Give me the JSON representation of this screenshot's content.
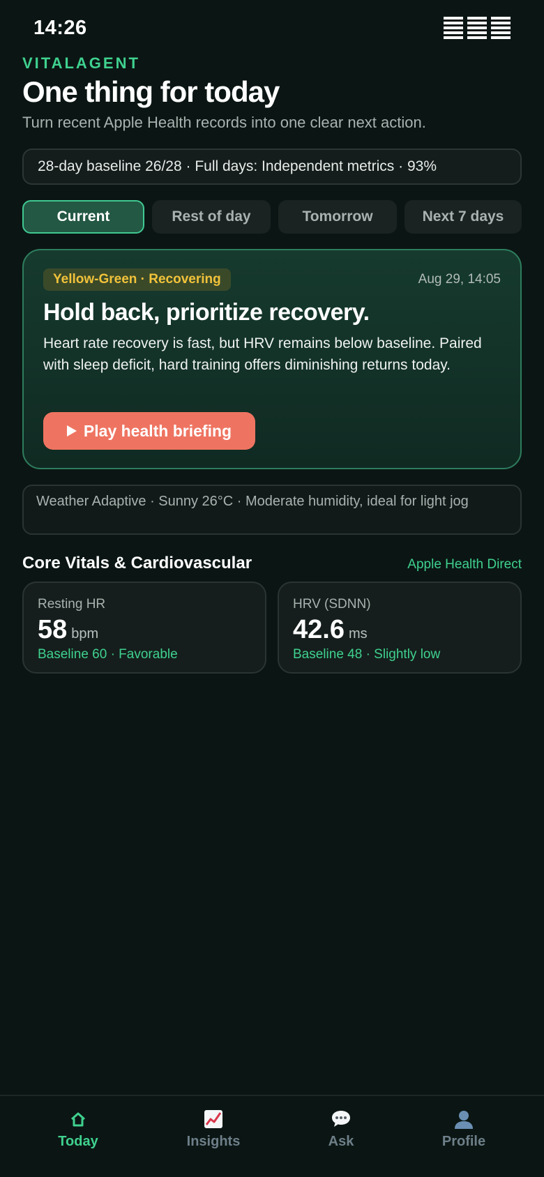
{
  "status_bar": {
    "time": "14:26",
    "icons": [
      "signal-icon",
      "wifi-icon",
      "battery-icon"
    ]
  },
  "header": {
    "brand": "VITALAGENT",
    "title": "One thing for today",
    "subtitle": "Turn recent Apple Health records into one clear next action."
  },
  "baseline": {
    "text": "28-day baseline 26/28 · Full days: Independent metrics · 93%"
  },
  "tabs": [
    {
      "label": "Current",
      "active": true
    },
    {
      "label": "Rest of day",
      "active": false
    },
    {
      "label": "Tomorrow",
      "active": false
    },
    {
      "label": "Next 7 days",
      "active": false
    }
  ],
  "recommendation": {
    "status_chip": "Yellow-Green · Recovering",
    "timestamp": "Aug 29, 14:05",
    "headline": "Hold back, prioritize recovery.",
    "body": "Heart rate recovery is fast, but HRV remains below baseline. Paired with sleep deficit, hard training offers diminishing returns today.",
    "play_button": "Play health briefing"
  },
  "weather": {
    "text": "Weather Adaptive · Sunny 26°C · Moderate humidity, ideal for light jog"
  },
  "section": {
    "title": "Core Vitals & Cardiovascular",
    "source_link": "Apple Health Direct"
  },
  "metrics": [
    {
      "label": "Resting HR",
      "value": "58",
      "unit": "bpm",
      "note": "Baseline 60 · Favorable"
    },
    {
      "label": "HRV (SDNN)",
      "value": "42.6",
      "unit": "ms",
      "note": "Baseline 48 · Slightly low"
    }
  ],
  "bottom_nav": [
    {
      "label": "Today",
      "icon": "home-icon",
      "active": true
    },
    {
      "label": "Insights",
      "icon": "chart-icon",
      "active": false
    },
    {
      "label": "Ask",
      "icon": "chat-bubble-icon",
      "active": false
    },
    {
      "label": "Profile",
      "icon": "person-icon",
      "active": false
    }
  ],
  "colors": {
    "background": "#0b1614",
    "accent_green": "#3fd18f",
    "chip_yellow": "#f2c23a",
    "cta_coral": "#ee7461",
    "nav_inactive": "#6e7f89"
  }
}
